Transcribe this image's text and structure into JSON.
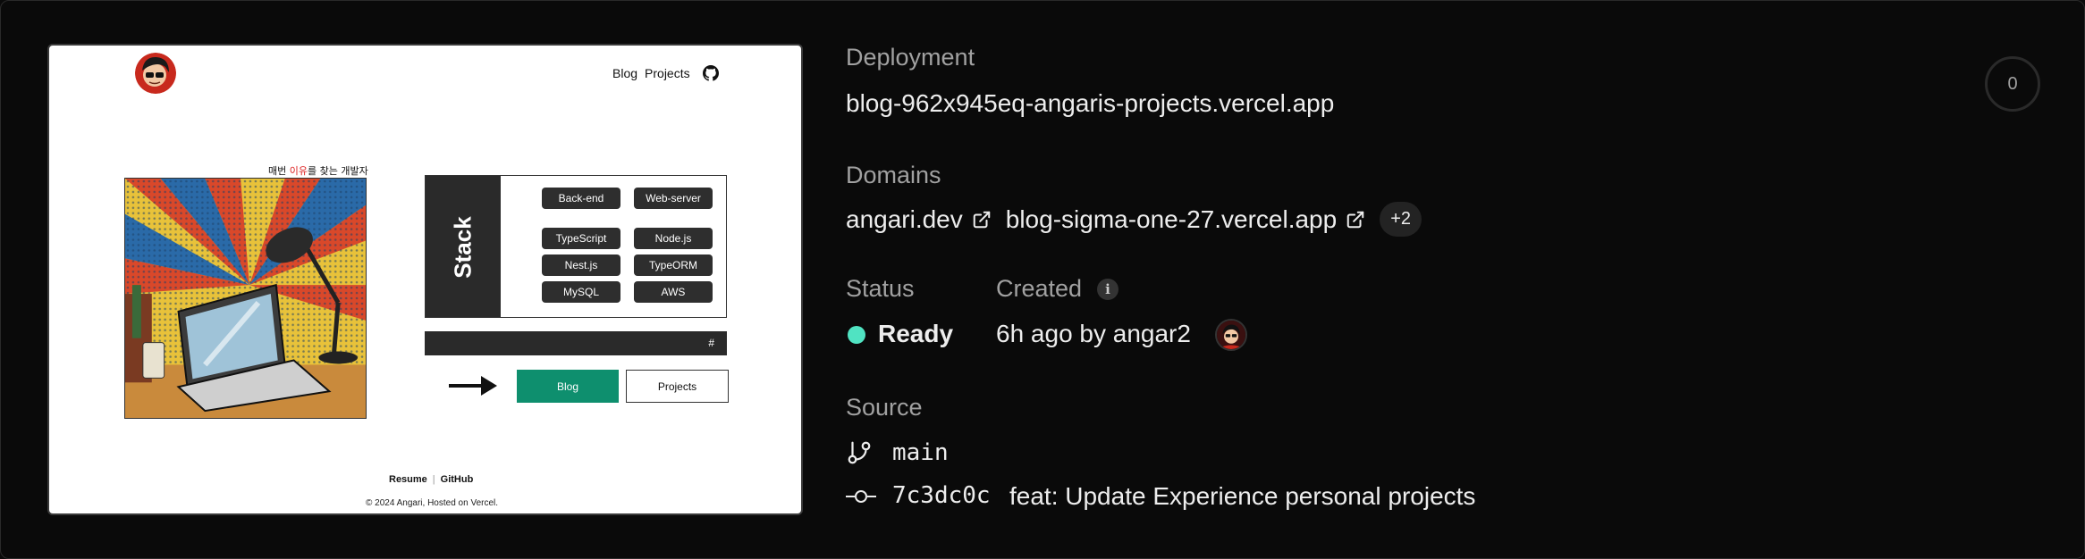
{
  "preview": {
    "nav": {
      "blog": "Blog",
      "projects": "Projects"
    },
    "tagline": {
      "prefix": "매번 ",
      "highlight": "이유",
      "suffix": "를 찾는 개발자"
    },
    "stack_title": "Stack",
    "chips": [
      "Back-end",
      "Web-server",
      "TypeScript",
      "Node.js",
      "Nest.js",
      "TypeORM",
      "MySQL",
      "AWS"
    ],
    "hash": "#",
    "blog_button": "Blog",
    "projects_button": "Projects",
    "footer_resume": "Resume",
    "footer_github": "GitHub",
    "copyright": "© 2024 Angari, Hosted on Vercel."
  },
  "deployment": {
    "label": "Deployment",
    "url": "blog-962x945eq-angaris-projects.vercel.app"
  },
  "domains": {
    "label": "Domains",
    "items": [
      "angari.dev",
      "blog-sigma-one-27.vercel.app"
    ],
    "more": "+2"
  },
  "status": {
    "label": "Status",
    "value": "Ready",
    "color": "#50e3c2"
  },
  "created": {
    "label": "Created",
    "value": "6h ago by angar2",
    "info_icon": "i"
  },
  "source": {
    "label": "Source",
    "branch": "main",
    "commit_hash": "7c3dc0c",
    "commit_message": "feat: Update Experience personal projects"
  },
  "counter": "0"
}
